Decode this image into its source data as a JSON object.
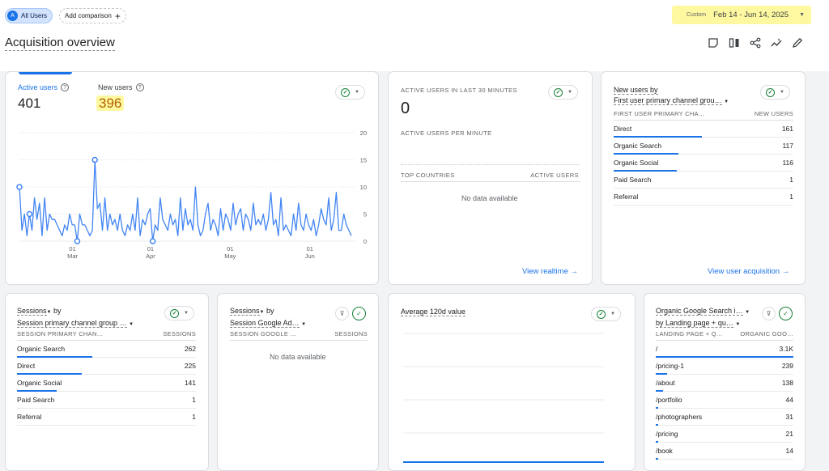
{
  "topbar": {
    "all_users_avatar": "A",
    "all_users_label": "All Users",
    "add_comparison_label": "Add comparison",
    "date_label": "Custom",
    "date_range": "Feb 14 - Jun 14, 2025"
  },
  "page": {
    "title": "Acquisition overview"
  },
  "toolbar_icons": [
    "report-icon",
    "compare-icon",
    "share-icon",
    "insights-icon",
    "edit-icon"
  ],
  "overview": {
    "active_users_label": "Active users",
    "active_users_value": "401",
    "new_users_label": "New users",
    "new_users_value": "396",
    "chart_data": {
      "type": "line",
      "y_ticks": [
        "20",
        "15",
        "10",
        "5",
        "0"
      ],
      "ylim": [
        0,
        20
      ],
      "x_ticks": [
        {
          "day": "01",
          "month": "Mar"
        },
        {
          "day": "01",
          "month": "Apr"
        },
        {
          "day": "01",
          "month": "May"
        },
        {
          "day": "01",
          "month": "Jun"
        }
      ],
      "values": [
        10,
        2,
        5,
        1,
        5,
        2,
        8,
        4,
        7,
        1,
        8,
        2,
        5,
        4,
        4,
        3,
        2,
        1,
        3,
        2,
        5,
        3,
        3,
        0,
        5,
        3,
        3,
        2,
        1,
        2,
        15,
        6,
        7,
        2,
        8,
        2,
        5,
        3,
        4,
        2,
        5,
        2,
        1,
        3,
        2,
        5,
        2,
        8,
        1,
        4,
        3,
        5,
        6,
        0,
        3,
        2,
        8,
        4,
        3,
        2,
        5,
        3,
        4,
        1,
        8,
        2,
        6,
        3,
        4,
        2,
        10,
        3,
        1,
        2,
        5,
        7,
        2,
        4,
        3,
        1,
        6,
        2,
        5,
        4,
        2,
        7,
        3,
        5,
        6,
        2,
        5,
        4,
        2,
        7,
        3,
        4,
        3,
        5,
        2,
        4,
        9,
        3,
        4,
        1,
        8,
        2,
        3,
        2,
        1,
        5,
        2,
        7,
        3,
        2,
        5,
        3,
        2,
        4,
        1,
        3,
        6,
        4,
        3,
        8,
        2,
        4,
        9,
        2,
        2,
        5,
        3,
        2,
        1
      ],
      "markers": [
        0,
        4,
        23,
        30,
        53
      ]
    }
  },
  "realtime": {
    "title": "ACTIVE USERS IN LAST 30 MINUTES",
    "value": "0",
    "per_minute": "ACTIVE USERS PER MINUTE",
    "col1": "TOP COUNTRIES",
    "col2": "ACTIVE USERS",
    "no_data": "No data available",
    "link": "View realtime"
  },
  "new_users": {
    "title_line1": "New users by",
    "title_line2": "First user primary channel grou…",
    "col1": "FIRST USER PRIMARY CHA…",
    "col2": "NEW USERS",
    "rows": [
      {
        "label": "Direct",
        "value": "161",
        "pct": 0.49
      },
      {
        "label": "Organic Search",
        "value": "117",
        "pct": 0.36
      },
      {
        "label": "Organic Social",
        "value": "116",
        "pct": 0.35
      },
      {
        "label": "Paid Search",
        "value": "1",
        "pct": 0
      },
      {
        "label": "Referral",
        "value": "1",
        "pct": 0
      }
    ],
    "link": "View user acquisition"
  },
  "sessions": {
    "title_line1": "Sessions",
    "title_by": "by",
    "title_line2": "Session primary channel group …",
    "col1": "SESSION PRIMARY CHAN…",
    "col2": "SESSIONS",
    "rows": [
      {
        "label": "Organic Search",
        "value": "262",
        "pct": 0.42
      },
      {
        "label": "Direct",
        "value": "225",
        "pct": 0.36
      },
      {
        "label": "Organic Social",
        "value": "141",
        "pct": 0.22
      },
      {
        "label": "Paid Search",
        "value": "1",
        "pct": 0
      },
      {
        "label": "Referral",
        "value": "1",
        "pct": 0
      }
    ]
  },
  "sessions_ads": {
    "title_line1": "Sessions",
    "title_by": "by",
    "title_line2": "Session Google Ad…",
    "col1": "SESSION GOOGLE …",
    "col2": "SESSIONS",
    "no_data": "No data available"
  },
  "avg120": {
    "title": "Average 120d value"
  },
  "organic": {
    "title_line1": "Organic Google Search i…",
    "title_line2": "by Landing page + qu…",
    "col1": "LANDING PAGE + Q…",
    "col2": "ORGANIC GOO…",
    "rows": [
      {
        "label": "/",
        "value": "3.1K",
        "pct": 1.0
      },
      {
        "label": "/pricing-1",
        "value": "239",
        "pct": 0.08
      },
      {
        "label": "/about",
        "value": "138",
        "pct": 0.05
      },
      {
        "label": "/portfolio",
        "value": "44",
        "pct": 0.015
      },
      {
        "label": "/photographers",
        "value": "31",
        "pct": 0.01
      },
      {
        "label": "/pricing",
        "value": "21",
        "pct": 0.007
      },
      {
        "label": "/book",
        "value": "14",
        "pct": 0.005
      }
    ]
  }
}
